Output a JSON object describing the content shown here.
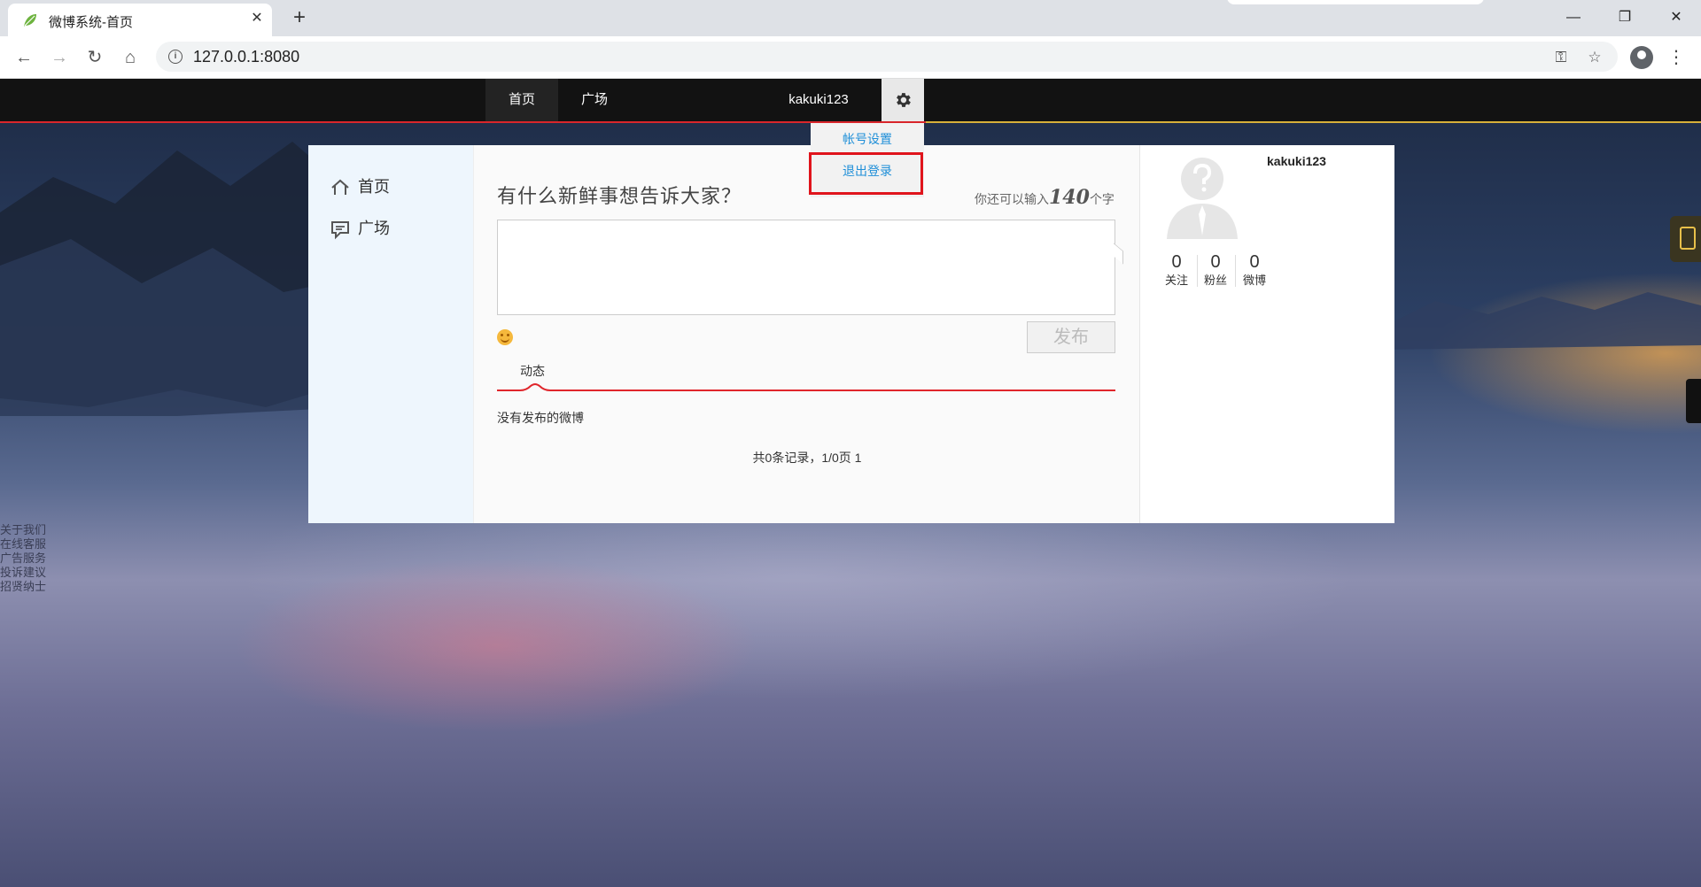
{
  "browser": {
    "tab_title": "微博系统-首页",
    "tab_close": "✕",
    "new_tab": "+",
    "url": "127.0.0.1:8080",
    "window_controls": {
      "minimize": "—",
      "restore": "❐",
      "close": "✕"
    },
    "back_glyph": "←",
    "forward_glyph": "→",
    "reload_glyph": "↻",
    "home_glyph": "⌂",
    "info_glyph": "i",
    "key_glyph": "⚿",
    "star_glyph": "☆",
    "menu_glyph": "⋮"
  },
  "site_nav": {
    "home": "首页",
    "square": "广场",
    "username": "kakuki123"
  },
  "dropdown": {
    "account_settings": "帐号设置",
    "logout": "退出登录"
  },
  "sidebar": {
    "items": [
      {
        "label": "首页",
        "icon": "home-icon"
      },
      {
        "label": "广场",
        "icon": "chat-icon"
      }
    ]
  },
  "composer": {
    "title": "有什么新鲜事想告诉大家？",
    "hint_prefix": "你还可以输入",
    "hint_count": "140",
    "hint_suffix": "个字",
    "publish_label": "发布",
    "tab_label": "动态"
  },
  "feed": {
    "empty_text": "没有发布的微博",
    "pagination": "共0条记录，1/0页 1"
  },
  "profile": {
    "name": "kakuki123",
    "stats": [
      {
        "value": "0",
        "label": "关注"
      },
      {
        "value": "0",
        "label": "粉丝"
      },
      {
        "value": "0",
        "label": "微博"
      }
    ]
  },
  "footer_links": [
    "关于我们",
    "在线客服",
    "广告服务",
    "投诉建议",
    "招贤纳士"
  ],
  "colors": {
    "nav_bg": "#121212",
    "nav_red_line": "#d9262b",
    "dropdown_link": "#1f8fd8",
    "highlight_box": "#e0141c"
  }
}
